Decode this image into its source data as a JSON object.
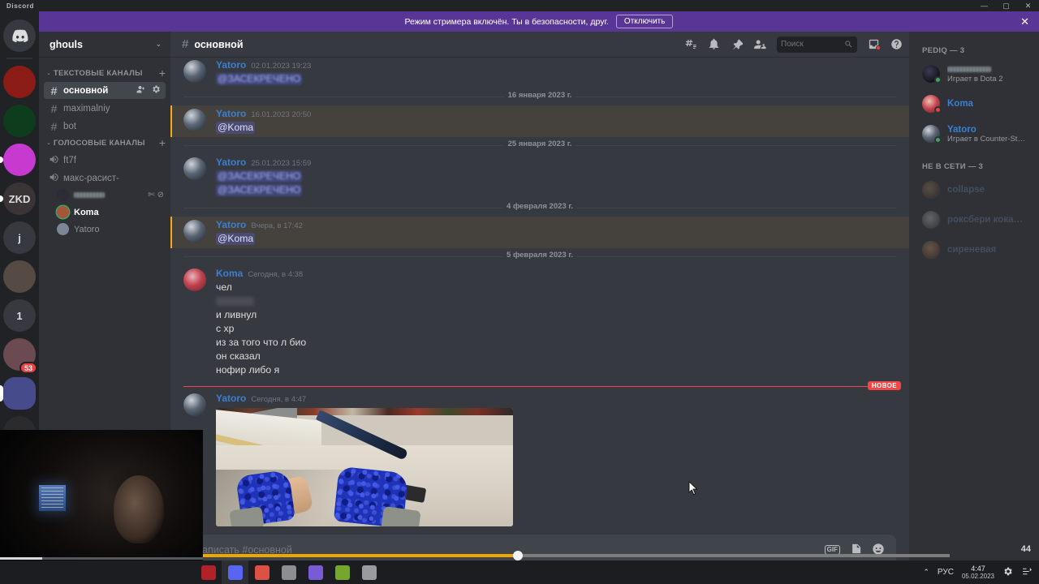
{
  "window": {
    "title": "Discord",
    "minimize": "—",
    "maximize": "▢",
    "close": "✕"
  },
  "streamer_banner": {
    "text": "Режим стримера включён. Ты в безопасности, друг.",
    "button": "Отключить",
    "close": "✕",
    "color": "#593695"
  },
  "guild_rail": {
    "items": [
      {
        "name": "discord-home",
        "label": "",
        "badge": "",
        "active": false,
        "pill": false,
        "color": "#5865f2"
      },
      {
        "name": "server-red",
        "label": "",
        "badge": "",
        "active": false,
        "pill": false,
        "color": "#8c1c16"
      },
      {
        "name": "server-green",
        "label": "",
        "badge": "",
        "active": false,
        "pill": false,
        "color": "#0d3d1c"
      },
      {
        "name": "server-magenta",
        "label": "",
        "badge": "",
        "active": false,
        "pill": true,
        "color": "#c63ad0"
      },
      {
        "name": "server-zkd",
        "label": "ZKD",
        "badge": "",
        "active": false,
        "pill": true,
        "color": "#3a3436"
      },
      {
        "name": "server-j",
        "label": "j",
        "badge": "",
        "active": false,
        "pill": false,
        "color": "#36393f"
      },
      {
        "name": "server-photo",
        "label": "",
        "badge": "",
        "active": false,
        "pill": false,
        "color": "#554b44"
      },
      {
        "name": "server-one",
        "label": "1",
        "badge": "",
        "active": false,
        "pill": false,
        "color": "#36393f"
      },
      {
        "name": "server-girl",
        "label": "",
        "badge": "53",
        "active": false,
        "pill": false,
        "color": "#6b4a52"
      },
      {
        "name": "server-ghouls",
        "label": "",
        "badge": "",
        "active": true,
        "pill": true,
        "color": "#464b8c"
      },
      {
        "name": "server-statue",
        "label": "",
        "badge": "",
        "active": false,
        "pill": false,
        "color": "#2b2b2d"
      },
      {
        "name": "server-dark",
        "label": "",
        "badge": "",
        "active": false,
        "pill": false,
        "color": "#0b0b22"
      },
      {
        "name": "add-server",
        "label": "",
        "badge": "",
        "active": false,
        "pill": false,
        "color": "#36393f"
      },
      {
        "name": "server-man",
        "label": "",
        "badge": "",
        "active": false,
        "pill": false,
        "color": "#b9bcc4"
      }
    ]
  },
  "sidebar": {
    "guild_name": "ghouls",
    "chevron": "⌄",
    "categories": [
      {
        "label": "Текстовые каналы",
        "arrow": "⌄",
        "plus": "+",
        "channels": [
          {
            "name": "основной",
            "hash": "#",
            "active": true,
            "actions": [
              "invite",
              "settings"
            ]
          },
          {
            "name": "maximalniy",
            "hash": "#",
            "active": false,
            "actions": []
          },
          {
            "name": "bot",
            "hash": "#",
            "active": false,
            "actions": []
          }
        ]
      },
      {
        "label": "Голосовые каналы",
        "arrow": "⌄",
        "plus": "+",
        "channels": [
          {
            "name": "ft7f",
            "hash": "speaker",
            "active": false,
            "actions": []
          },
          {
            "name": "макс-расист-",
            "hash": "speaker",
            "active": false,
            "actions": []
          }
        ]
      }
    ],
    "voice_members": [
      {
        "name": "",
        "blurred": true,
        "speaking": false,
        "muted": true,
        "deafened": true
      },
      {
        "name": "Koma",
        "blurred": false,
        "speaking": true,
        "muted": false,
        "deafened": false
      },
      {
        "name": "Yatoro",
        "blurred": false,
        "speaking": false,
        "muted": false,
        "deafened": false
      }
    ]
  },
  "chat_header": {
    "hash": "#",
    "channel": "основной",
    "icons": [
      "threads-icon",
      "bell-icon",
      "pin-icon",
      "members-icon",
      "inbox-icon",
      "help-icon"
    ],
    "search_placeholder": "Поиск"
  },
  "messages": [
    {
      "type": "message",
      "author": "Yatoro",
      "timestamp": "02.01.2023 19:23",
      "mention": false,
      "lines": [
        {
          "kind": "blurred-mention",
          "text": "@ЗАСЕКРЕЧЕНО"
        }
      ]
    },
    {
      "type": "divider",
      "label": "16 января 2023 г."
    },
    {
      "type": "message",
      "author": "Yatoro",
      "timestamp": "16.01.2023 20:50",
      "mention": true,
      "lines": [
        {
          "kind": "mention",
          "text": "@Koma"
        }
      ]
    },
    {
      "type": "divider",
      "label": "25 января 2023 г."
    },
    {
      "type": "message",
      "author": "Yatoro",
      "timestamp": "25.01.2023 15:59",
      "mention": false,
      "lines": [
        {
          "kind": "blurred-mention",
          "text": "@ЗАСЕКРЕЧЕНО"
        },
        {
          "kind": "blurred-mention",
          "text": "@ЗАСЕКРЕЧЕНО"
        }
      ]
    },
    {
      "type": "divider",
      "label": "4 февраля 2023 г."
    },
    {
      "type": "message",
      "author": "Yatoro",
      "timestamp": "Вчера, в 17:42",
      "mention": true,
      "lines": [
        {
          "kind": "mention",
          "text": "@Koma"
        }
      ]
    },
    {
      "type": "divider",
      "label": "5 февраля 2023 г."
    },
    {
      "type": "message",
      "author": "Koma",
      "timestamp": "Сегодня, в 4:38",
      "mention": false,
      "lines": [
        {
          "kind": "text",
          "text": "чел"
        },
        {
          "kind": "redacted",
          "text": ""
        },
        {
          "kind": "text",
          "text": "и ливнул"
        },
        {
          "kind": "text",
          "text": "с хр"
        },
        {
          "kind": "text",
          "text": "из за того что л био"
        },
        {
          "kind": "text",
          "text": "он сказал"
        },
        {
          "kind": "text",
          "text": "нофир либо я"
        }
      ]
    },
    {
      "type": "new-divider",
      "label": "НОВОЕ"
    },
    {
      "type": "message",
      "author": "Yatoro",
      "timestamp": "Сегодня, в 4:47",
      "mention": false,
      "lines": [],
      "attachment": "csgo-screenshot"
    }
  ],
  "composer": {
    "placeholder": "Написать #основной",
    "gif_label": "GIF",
    "icons": [
      "gif-button",
      "sticker-icon",
      "emoji-icon"
    ]
  },
  "member_list": {
    "groups": [
      {
        "label": "PEDIQ — 3",
        "members": [
          {
            "name": "",
            "blurred": true,
            "activity": "Играет в Dota 2",
            "status": "online",
            "color": "default"
          },
          {
            "name": "Koma",
            "blurred": false,
            "activity": "",
            "status": "dnd",
            "color": "blue"
          },
          {
            "name": "Yatoro",
            "blurred": false,
            "activity": "Играет в Counter-Strike: Glob...",
            "status": "online",
            "color": "blue"
          }
        ]
      },
      {
        "label": "НЕ В СЕТИ — 3",
        "members": [
          {
            "name": "collapse",
            "blurred": false,
            "activity": "",
            "status": "offline",
            "color": "blue"
          },
          {
            "name": "роксбери кокаиновы...",
            "blurred": false,
            "activity": "",
            "status": "offline",
            "color": "blue"
          },
          {
            "name": "сиреневая",
            "blurred": false,
            "activity": "",
            "status": "offline",
            "color": "blue"
          }
        ]
      }
    ]
  },
  "video_overlay": {
    "play_icon": "▶",
    "volume_icon": "🔊",
    "counter": "44"
  },
  "taskbar": {
    "apps": [
      {
        "name": "app-red",
        "color": "#b2202a",
        "active": false
      },
      {
        "name": "discord-app",
        "color": "#5865f2",
        "active": true
      },
      {
        "name": "chrome-app",
        "color": "#dd5044",
        "active": false
      },
      {
        "name": "settings-app",
        "color": "#8b8e93",
        "active": false
      },
      {
        "name": "gem-app",
        "color": "#7a5bd6",
        "active": false
      },
      {
        "name": "green-app",
        "color": "#76a72a",
        "active": false
      },
      {
        "name": "grey-app",
        "color": "#9a9ba0",
        "active": false
      }
    ],
    "chevron": "⌃",
    "language": "РУС",
    "time": "4:47",
    "date": "05.02.2023",
    "tray_icons": [
      "gear-icon",
      "network-icon"
    ]
  }
}
